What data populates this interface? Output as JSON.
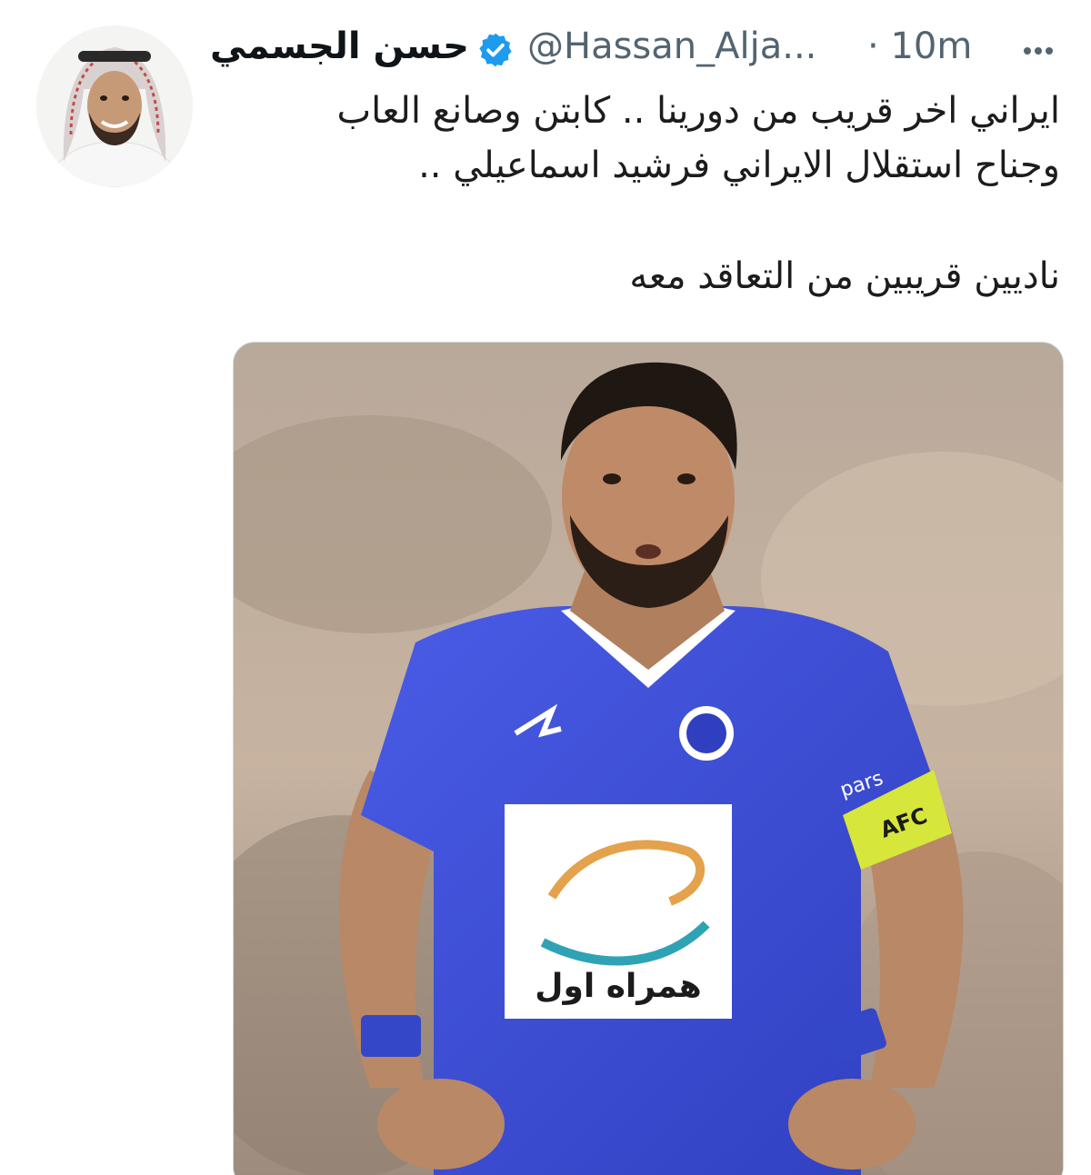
{
  "author": {
    "display_name": "حسن الجسمي",
    "handle": "@Hassan_Alja...",
    "time_separator": "·",
    "time": "10m",
    "verified": true
  },
  "icons": {
    "verified": "verified-badge-icon",
    "more": "more-options-icon",
    "avatar": "profile-avatar"
  },
  "tweet": {
    "lines": [
      "ايراني اخر قريب من دورينا .. كابتن وصانع العاب",
      "وجناح  استقلال الايراني فرشيد اسماعيلي ..",
      "ناديين قريبين من التعاقد معه"
    ]
  },
  "media": {
    "kit_sponsor_text": "همراه اول",
    "sleeve_sponsor": "pars",
    "captain_band": "AFC"
  },
  "colors": {
    "verified": "#1d9bf0",
    "muted": "#536471",
    "jersey": "#3b4fd6"
  }
}
